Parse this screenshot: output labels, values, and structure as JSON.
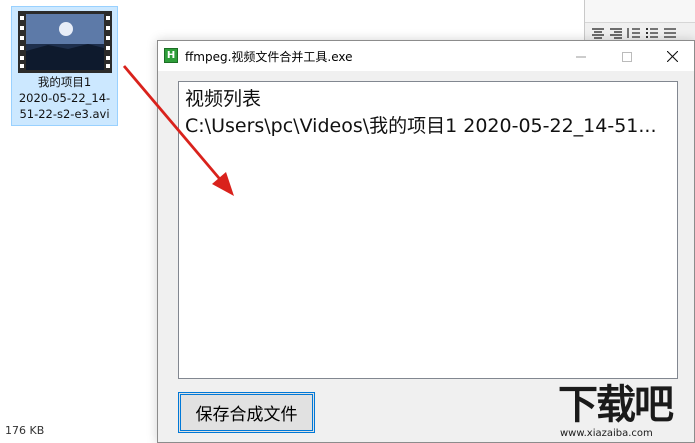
{
  "desktop": {
    "file": {
      "name_lines": [
        "我的项目1",
        "2020-05-22_14-",
        "51-22-s2-e3.avi"
      ]
    },
    "status_size": "176 KB"
  },
  "app": {
    "title": "ffmpeg.视频文件合并工具.exe",
    "icon_letter": "H",
    "list_lines": [
      "视频列表",
      "C:\\Users\\pc\\Videos\\我的项目1 2020-05-22_14-51..."
    ],
    "save_button_label": "保存合成文件"
  },
  "watermark": {
    "big": "下载吧",
    "small": "www.xiazaiba.com"
  },
  "colors": {
    "selection_bg": "#cce8ff",
    "arrow": "#d9221c",
    "focus_border": "#0078d7"
  },
  "icons": {
    "minimize": "minimize-icon",
    "maximize": "maximize-icon",
    "close": "close-icon"
  }
}
